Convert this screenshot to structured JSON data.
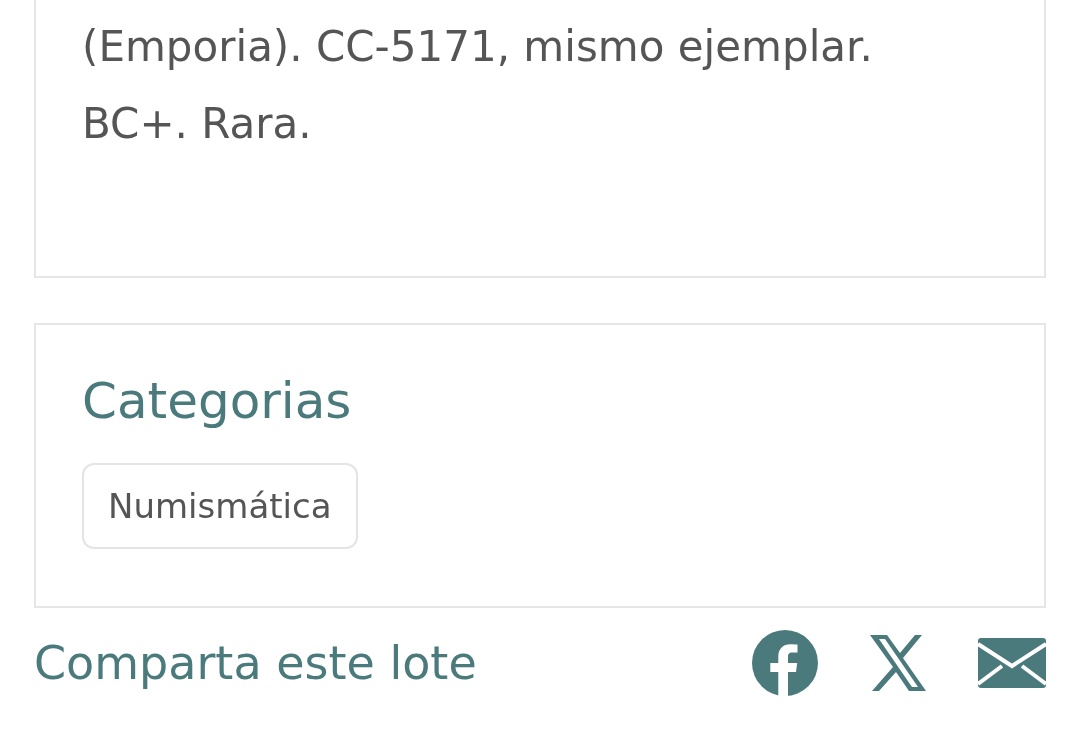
{
  "description": {
    "lines": [
      "(Emporia). CC-5171, mismo ejemplar.",
      "BC+. Rara."
    ]
  },
  "categories": {
    "title": "Categorias",
    "tags": [
      "Numismática"
    ]
  },
  "share": {
    "label": "Comparta este lote",
    "icons": [
      {
        "kind": "facebook"
      },
      {
        "kind": "x"
      },
      {
        "kind": "mail"
      }
    ]
  }
}
